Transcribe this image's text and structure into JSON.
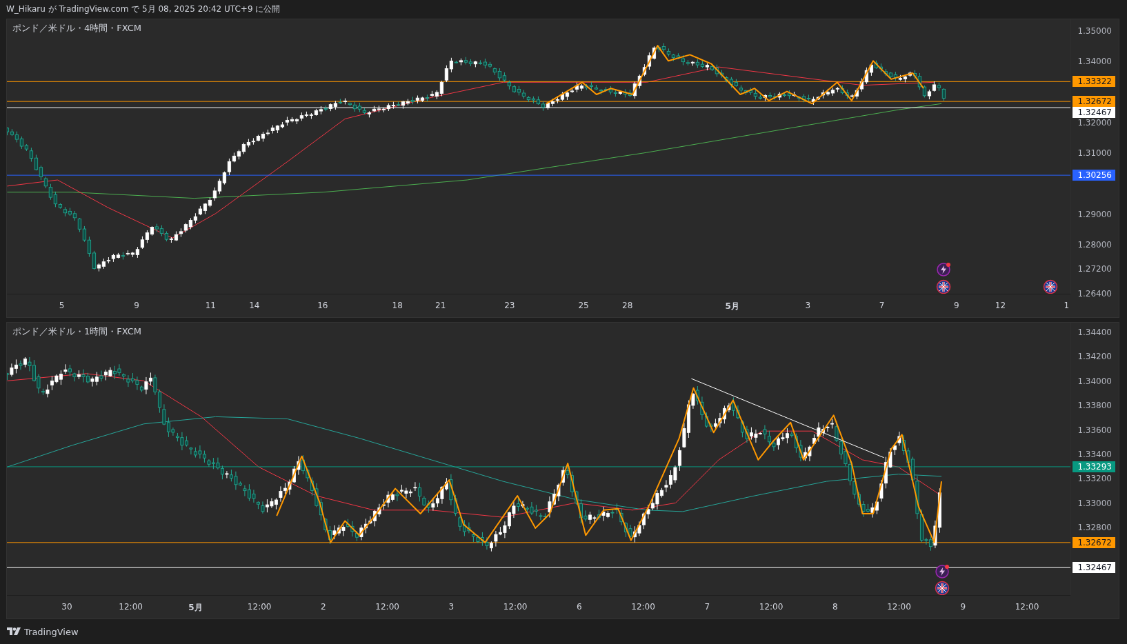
{
  "header": {
    "text": "W_Hikaru が TradingView.com で 5月 08, 2025 20:42 UTC+9 に公開"
  },
  "panes": [
    {
      "title": "ポンド／米ドル・4時間・FXCM",
      "ticks": [
        "1.35000",
        "1.34000",
        "1.32000",
        "1.31000",
        "1.29000",
        "1.28000",
        "1.27200",
        "1.26400"
      ],
      "levels": [
        {
          "price": "1.33322",
          "color": "#ff9800"
        },
        {
          "price": "1.32672",
          "color": "#ff9800"
        },
        {
          "price": "1.32467",
          "color": "#ffffff"
        },
        {
          "price": "1.30256",
          "color": "#2962ff"
        }
      ],
      "time_labels": [
        {
          "text": "5",
          "kind": "day"
        },
        {
          "text": "9",
          "kind": "day"
        },
        {
          "text": "11",
          "kind": "day"
        },
        {
          "text": "14",
          "kind": "day"
        },
        {
          "text": "16",
          "kind": "day"
        },
        {
          "text": "18",
          "kind": "day"
        },
        {
          "text": "21",
          "kind": "day"
        },
        {
          "text": "23",
          "kind": "day"
        },
        {
          "text": "25",
          "kind": "day"
        },
        {
          "text": "28",
          "kind": "day"
        },
        {
          "text": "5月",
          "kind": "month"
        },
        {
          "text": "3",
          "kind": "day"
        },
        {
          "text": "7",
          "kind": "day"
        },
        {
          "text": "9",
          "kind": "day"
        },
        {
          "text": "12",
          "kind": "day"
        },
        {
          "text": "1",
          "kind": "day"
        }
      ]
    },
    {
      "title": "ポンド／米ドル・1時間・FXCM",
      "ticks": [
        "1.34400",
        "1.34200",
        "1.34000",
        "1.33800",
        "1.33600",
        "1.33400",
        "1.33200",
        "1.33000",
        "1.32800"
      ],
      "levels": [
        {
          "price": "1.33293",
          "color": "#089981"
        },
        {
          "price": "1.32672",
          "color": "#ff9800"
        },
        {
          "price": "1.32467",
          "color": "#ffffff"
        }
      ],
      "time_labels": [
        {
          "text": "30",
          "kind": "day"
        },
        {
          "text": "12:00",
          "kind": "day"
        },
        {
          "text": "5月",
          "kind": "month"
        },
        {
          "text": "12:00",
          "kind": "day"
        },
        {
          "text": "2",
          "kind": "day"
        },
        {
          "text": "12:00",
          "kind": "day"
        },
        {
          "text": "3",
          "kind": "day"
        },
        {
          "text": "12:00",
          "kind": "day"
        },
        {
          "text": "6",
          "kind": "day"
        },
        {
          "text": "12:00",
          "kind": "day"
        },
        {
          "text": "7",
          "kind": "day"
        },
        {
          "text": "12:00",
          "kind": "day"
        },
        {
          "text": "8",
          "kind": "day"
        },
        {
          "text": "12:00",
          "kind": "day"
        },
        {
          "text": "9",
          "kind": "day"
        },
        {
          "text": "12:00",
          "kind": "day"
        }
      ]
    }
  ],
  "footer": {
    "brand": "TradingView"
  }
}
